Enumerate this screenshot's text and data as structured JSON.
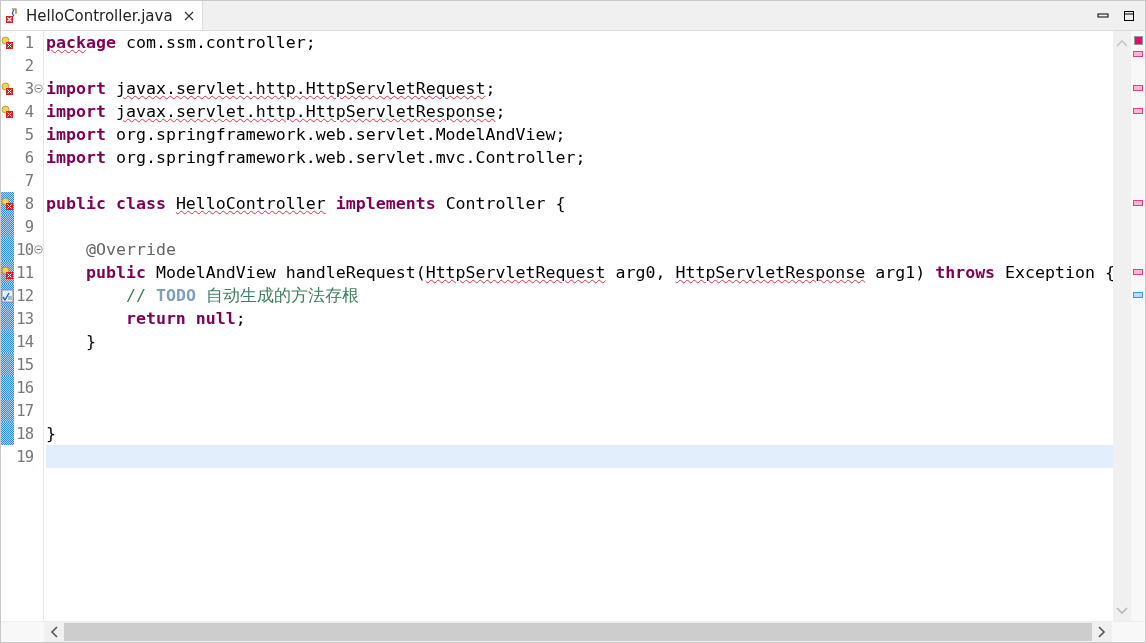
{
  "tab": {
    "title": "HelloController.java",
    "selected": true,
    "has_error": true
  },
  "lines": [
    {
      "number": "1",
      "kind": "error",
      "fold": false,
      "changed": false,
      "selected": false,
      "tokens": [
        {
          "kind": "kw-error",
          "text": "pack"
        },
        {
          "kind": "kw",
          "text": "age"
        },
        {
          "kind": "plain",
          "text": " com.ssm.controller;"
        }
      ]
    },
    {
      "number": "2",
      "kind": "plain",
      "fold": false,
      "changed": false,
      "selected": false
    },
    {
      "number": "3",
      "kind": "error",
      "fold": true,
      "changed": false,
      "selected": false,
      "tokens": [
        {
          "kind": "kw",
          "text": "import "
        },
        {
          "kind": "error",
          "text": "javax.servlet.http.HttpServletRequest"
        },
        {
          "kind": "plain",
          "text": ";"
        }
      ]
    },
    {
      "number": "4",
      "kind": "error",
      "fold": false,
      "changed": false,
      "selected": false,
      "tokens": [
        {
          "kind": "kw",
          "text": "import "
        },
        {
          "kind": "error",
          "text": "javax.servlet.http.HttpServletResponse"
        },
        {
          "kind": "plain",
          "text": ";"
        }
      ]
    },
    {
      "number": "5",
      "kind": "plain",
      "fold": false,
      "changed": false,
      "selected": false,
      "tokens": [
        {
          "kind": "kw",
          "text": "import"
        },
        {
          "kind": "plain",
          "text": " org.springframework.web.servlet.ModelAndView;"
        }
      ]
    },
    {
      "number": "6",
      "kind": "plain",
      "fold": false,
      "changed": false,
      "selected": false,
      "tokens": [
        {
          "kind": "kw",
          "text": "import"
        },
        {
          "kind": "plain",
          "text": " org.springframework.web.servlet.mvc.Controller;"
        }
      ]
    },
    {
      "number": "7",
      "kind": "plain",
      "fold": false,
      "changed": false,
      "selected": false
    },
    {
      "number": "8",
      "kind": "error",
      "fold": false,
      "changed": true,
      "selected": false,
      "tokens": [
        {
          "kind": "kw",
          "text": "public class "
        },
        {
          "kind": "error",
          "text": "HelloController"
        },
        {
          "kind": "kw",
          "text": " implements"
        },
        {
          "kind": "plain",
          "text": " Controller {"
        }
      ]
    },
    {
      "number": "9",
      "kind": "plain",
      "fold": false,
      "changed": true,
      "selected": false
    },
    {
      "number": "10",
      "kind": "plain",
      "fold": true,
      "changed": true,
      "selected": false,
      "tokens": [
        {
          "kind": "annot",
          "text": "    @Override"
        }
      ]
    },
    {
      "number": "11",
      "kind": "error",
      "fold": false,
      "changed": true,
      "selected": false,
      "tokens": [
        {
          "kind": "kw",
          "text": "    public"
        },
        {
          "kind": "plain",
          "text": " ModelAndView handleRequest("
        },
        {
          "kind": "error",
          "text": "HttpServletRequest"
        },
        {
          "kind": "plain",
          "text": " arg0, "
        },
        {
          "kind": "error",
          "text": "HttpServletResponse"
        },
        {
          "kind": "plain",
          "text": " arg1) "
        },
        {
          "kind": "kw",
          "text": "throws"
        },
        {
          "kind": "plain",
          "text": " Exception {"
        }
      ]
    },
    {
      "number": "12",
      "kind": "task",
      "fold": false,
      "changed": true,
      "selected": false,
      "tokens": [
        {
          "kind": "comment",
          "text": "        // "
        },
        {
          "kind": "todo",
          "text": "TODO"
        },
        {
          "kind": "comment",
          "text": " 自动生成的方法存根"
        }
      ]
    },
    {
      "number": "13",
      "kind": "plain",
      "fold": false,
      "changed": true,
      "selected": false,
      "tokens": [
        {
          "kind": "kw",
          "text": "        return null"
        },
        {
          "kind": "plain",
          "text": ";"
        }
      ]
    },
    {
      "number": "14",
      "kind": "plain",
      "fold": false,
      "changed": true,
      "selected": false,
      "tokens": [
        {
          "kind": "plain",
          "text": "    }"
        }
      ]
    },
    {
      "number": "15",
      "kind": "plain",
      "fold": false,
      "changed": true,
      "selected": false
    },
    {
      "number": "16",
      "kind": "plain",
      "fold": false,
      "changed": true,
      "selected": false
    },
    {
      "number": "17",
      "kind": "plain",
      "fold": false,
      "changed": true,
      "selected": false
    },
    {
      "number": "18",
      "kind": "plain",
      "fold": false,
      "changed": true,
      "selected": false,
      "tokens": [
        {
          "kind": "plain",
          "text": "}"
        }
      ]
    },
    {
      "number": "19",
      "kind": "plain",
      "fold": false,
      "changed": false,
      "selected": true
    }
  ]
}
